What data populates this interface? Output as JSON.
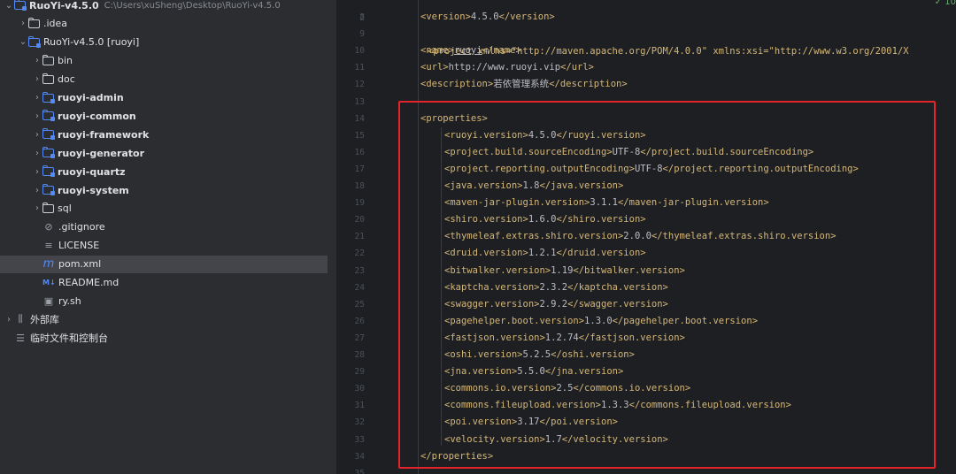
{
  "project_tree": {
    "root": {
      "name": "RuoYi-v4.5.0",
      "path": "C:\\Users\\xuSheng\\Desktop\\RuoYi-v4.5.0"
    },
    "items": [
      {
        "label": "RuoYi-v4.5.0",
        "extra": "C:\\Users\\xuSheng\\Desktop\\RuoYi-v4.5.0",
        "level": 0,
        "type": "module",
        "expanded": true,
        "bold": true
      },
      {
        "label": ".idea",
        "level": 1,
        "type": "folder",
        "expanded": false
      },
      {
        "label": "RuoYi-v4.5.0 [ruoyi]",
        "level": 1,
        "type": "module",
        "expanded": true
      },
      {
        "label": "bin",
        "level": 2,
        "type": "folder",
        "expanded": false
      },
      {
        "label": "doc",
        "level": 2,
        "type": "folder",
        "expanded": false
      },
      {
        "label": "ruoyi-admin",
        "level": 2,
        "type": "module",
        "expanded": false,
        "bold": true
      },
      {
        "label": "ruoyi-common",
        "level": 2,
        "type": "module",
        "expanded": false,
        "bold": true
      },
      {
        "label": "ruoyi-framework",
        "level": 2,
        "type": "module",
        "expanded": false,
        "bold": true
      },
      {
        "label": "ruoyi-generator",
        "level": 2,
        "type": "module",
        "expanded": false,
        "bold": true
      },
      {
        "label": "ruoyi-quartz",
        "level": 2,
        "type": "module",
        "expanded": false,
        "bold": true
      },
      {
        "label": "ruoyi-system",
        "level": 2,
        "type": "module",
        "expanded": false,
        "bold": true
      },
      {
        "label": "sql",
        "level": 2,
        "type": "folder",
        "expanded": false
      },
      {
        "label": ".gitignore",
        "level": 2,
        "type": "ignore-file"
      },
      {
        "label": "LICENSE",
        "level": 2,
        "type": "text-file"
      },
      {
        "label": "pom.xml",
        "level": 2,
        "type": "maven-file",
        "selected": true
      },
      {
        "label": "README.md",
        "level": 2,
        "type": "markdown-file"
      },
      {
        "label": "ry.sh",
        "level": 2,
        "type": "shell-file"
      },
      {
        "label": "外部库",
        "level": 0,
        "type": "library",
        "expanded": false
      },
      {
        "label": "临时文件和控制台",
        "level": 0,
        "type": "scratches"
      }
    ]
  },
  "editor": {
    "partial_top_line": "<project xmlns=\"http://maven.apache.org/POM/4.0.0\" xmlns:xsi=\"http://www.w3.org/2001/X",
    "inspection_badge": "✓ 10",
    "lines": [
      {
        "n": "8",
        "code": "<version>4.5.0</version>",
        "indent": 1
      },
      {
        "n": "9",
        "code": "",
        "indent": 1
      },
      {
        "n": "10",
        "code": "<name>ruoyi</name>",
        "indent": 1
      },
      {
        "n": "11",
        "code": "<url>http://www.ruoyi.vip</url>",
        "indent": 1
      },
      {
        "n": "12",
        "code": "<description>若依管理系统</description>",
        "indent": 1
      },
      {
        "n": "13",
        "code": "",
        "indent": 1
      },
      {
        "n": "14",
        "code": "<properties>",
        "indent": 1
      },
      {
        "n": "15",
        "code": "<ruoyi.version>4.5.0</ruoyi.version>",
        "indent": 2
      },
      {
        "n": "16",
        "code": "<project.build.sourceEncoding>UTF-8</project.build.sourceEncoding>",
        "indent": 2
      },
      {
        "n": "17",
        "code": "<project.reporting.outputEncoding>UTF-8</project.reporting.outputEncoding>",
        "indent": 2
      },
      {
        "n": "18",
        "code": "<java.version>1.8</java.version>",
        "indent": 2
      },
      {
        "n": "19",
        "code": "<maven-jar-plugin.version>3.1.1</maven-jar-plugin.version>",
        "indent": 2
      },
      {
        "n": "20",
        "code": "<shiro.version>1.6.0</shiro.version>",
        "indent": 2
      },
      {
        "n": "21",
        "code": "<thymeleaf.extras.shiro.version>2.0.0</thymeleaf.extras.shiro.version>",
        "indent": 2
      },
      {
        "n": "22",
        "code": "<druid.version>1.2.1</druid.version>",
        "indent": 2
      },
      {
        "n": "23",
        "code": "<bitwalker.version>1.19</bitwalker.version>",
        "indent": 2
      },
      {
        "n": "24",
        "code": "<kaptcha.version>2.3.2</kaptcha.version>",
        "indent": 2
      },
      {
        "n": "25",
        "code": "<swagger.version>2.9.2</swagger.version>",
        "indent": 2
      },
      {
        "n": "26",
        "code": "<pagehelper.boot.version>1.3.0</pagehelper.boot.version>",
        "indent": 2
      },
      {
        "n": "27",
        "code": "<fastjson.version>1.2.74</fastjson.version>",
        "indent": 2
      },
      {
        "n": "28",
        "code": "<oshi.version>5.2.5</oshi.version>",
        "indent": 2
      },
      {
        "n": "29",
        "code": "<jna.version>5.5.0</jna.version>",
        "indent": 2
      },
      {
        "n": "30",
        "code": "<commons.io.version>2.5</commons.io.version>",
        "indent": 2
      },
      {
        "n": "31",
        "code": "<commons.fileupload.version>1.3.3</commons.fileupload.version>",
        "indent": 2
      },
      {
        "n": "32",
        "code": "<poi.version>3.17</poi.version>",
        "indent": 2
      },
      {
        "n": "33",
        "code": "<velocity.version>1.7</velocity.version>",
        "indent": 2
      },
      {
        "n": "34",
        "code": "</properties>",
        "indent": 1
      },
      {
        "n": "35",
        "code": "",
        "indent": 1
      }
    ]
  },
  "colors": {
    "sidebar_bg": "#2b2d30",
    "editor_bg": "#1e1f22",
    "tag": "#d5b778",
    "text": "#bcbec4",
    "highlight_box": "#e3242b"
  }
}
